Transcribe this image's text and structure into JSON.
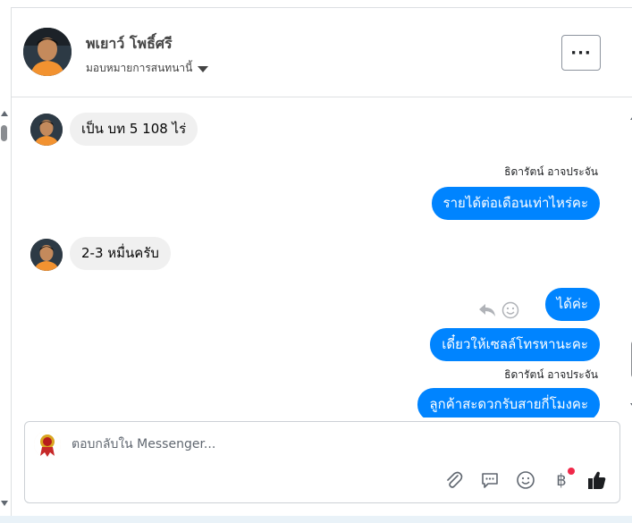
{
  "header": {
    "name": "พเยาว์ โพธิ์ศรี",
    "assign_label": "มอบหมายการสนทนานี้",
    "more_label": "···"
  },
  "messages": [
    {
      "direction": "in",
      "text": "เป็น บท 5   108 ไร่"
    },
    {
      "direction": "out",
      "sender": "ธิดารัตน์ อาจประจัน",
      "text": "รายได้ต่อเดือนเท่าไหร่คะ"
    },
    {
      "direction": "in",
      "text": "2-3 หมื่นครับ"
    },
    {
      "direction": "out",
      "text": "ได้ค่ะ"
    },
    {
      "direction": "out",
      "text": "เดี๋ยวให้เซลล์โทรหานะคะ"
    },
    {
      "direction": "out",
      "sender": "ธิดารัตน์ อาจประจัน",
      "text": "ลูกค้าสะดวกรับสายกี่โมงคะ"
    }
  ],
  "composer": {
    "placeholder": "ตอบกลับใน Messenger...",
    "currency_symbol": "฿"
  },
  "colors": {
    "outgoing_bubble": "#0084ff",
    "incoming_bubble": "#f0f0f0",
    "like": "#1c1e21",
    "notification_dot": "#f02849"
  },
  "icons": [
    "chevron-down-icon",
    "more-icon",
    "reply-icon",
    "emoji-icon",
    "attachment-icon",
    "quick-reply-icon",
    "smiley-icon",
    "baht-icon",
    "thumbs-up-icon"
  ]
}
